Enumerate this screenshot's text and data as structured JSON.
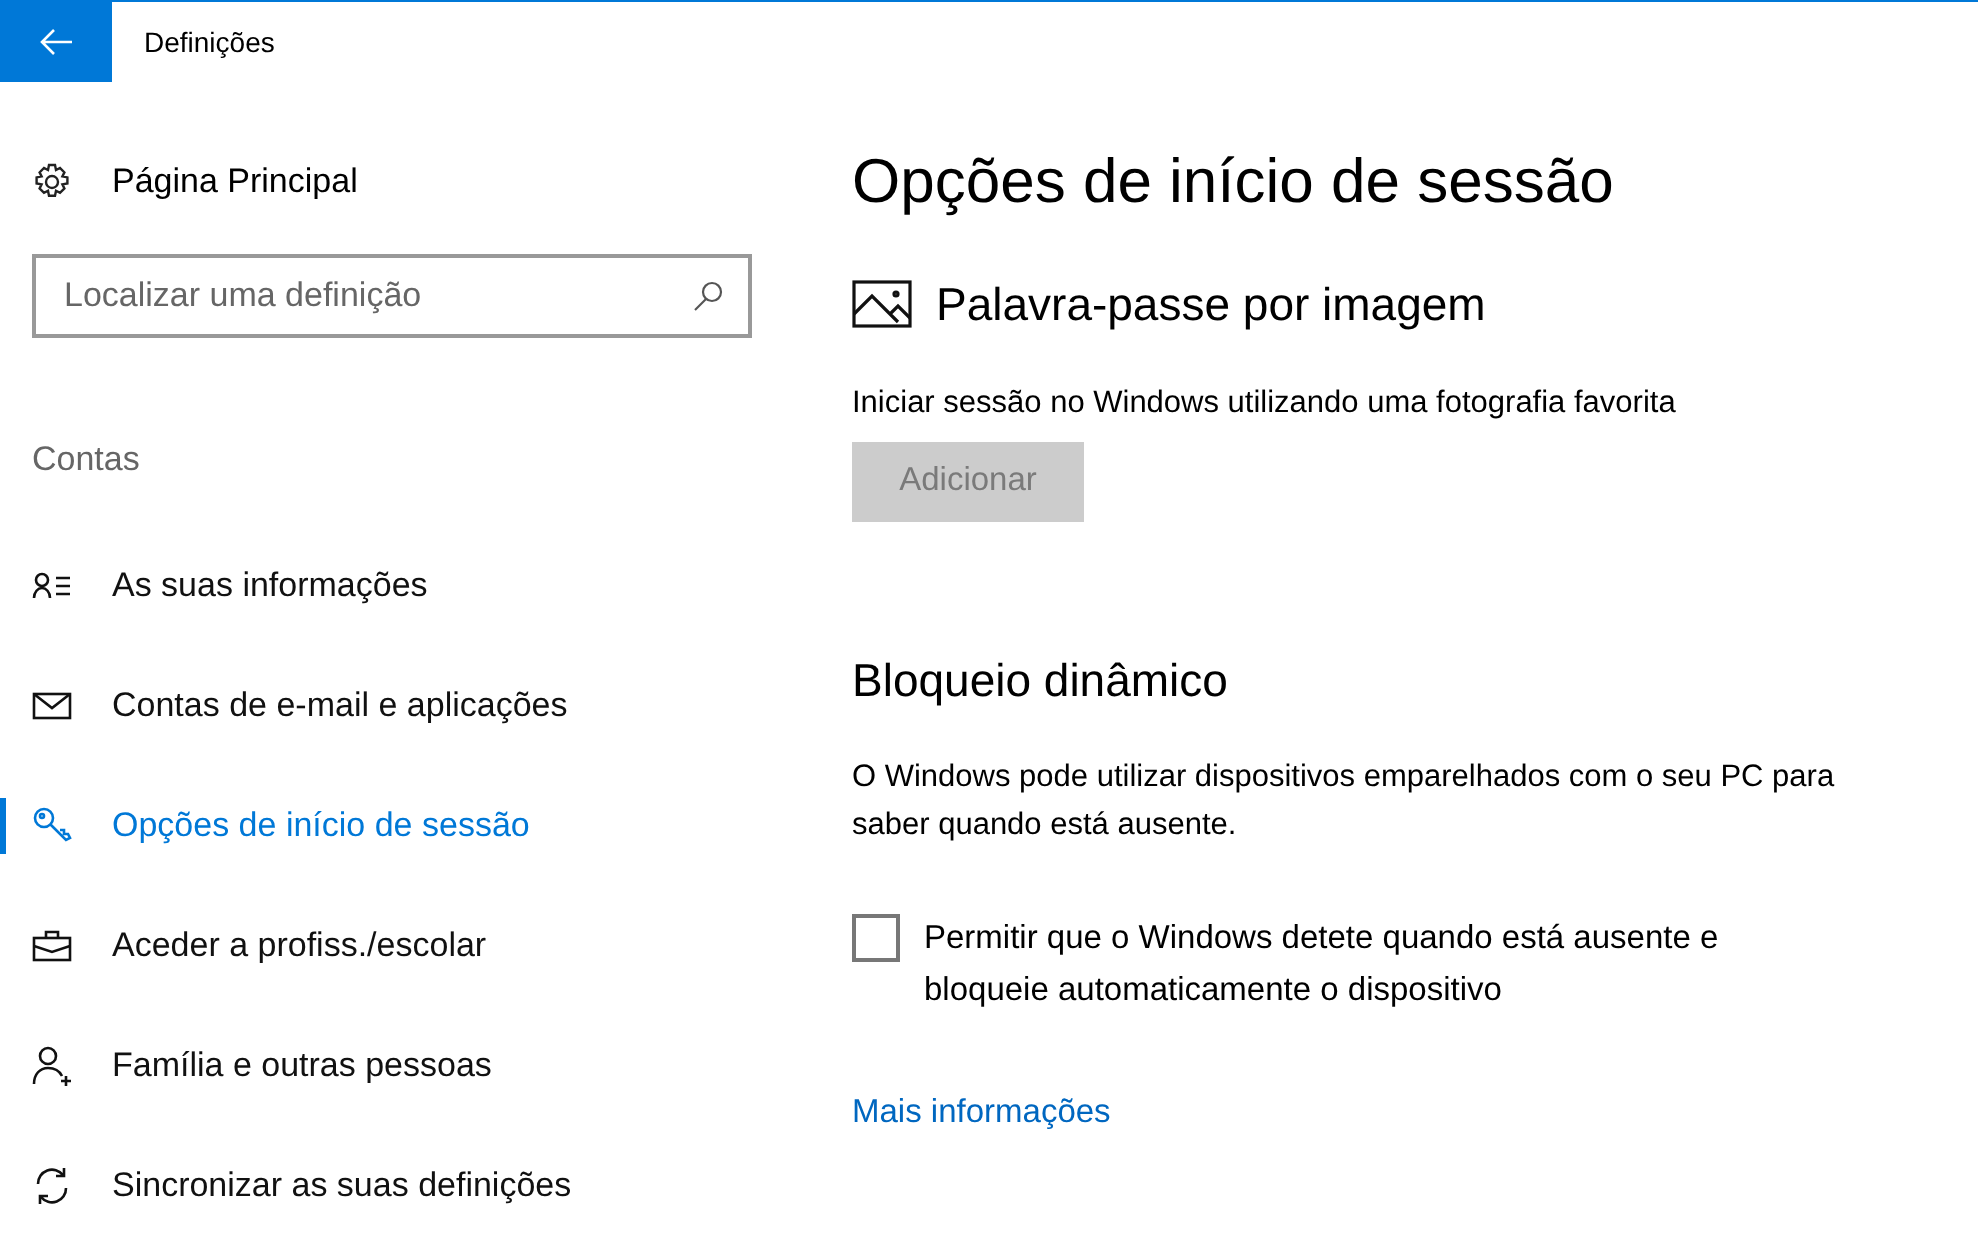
{
  "window": {
    "title": "Definições"
  },
  "sidebar": {
    "home": "Página Principal",
    "search": {
      "placeholder": "Localizar uma definição"
    },
    "section": "Contas",
    "items": [
      {
        "kind": "profile",
        "label": "As suas informações",
        "selected": false
      },
      {
        "kind": "mail",
        "label": "Contas de e-mail e aplicações",
        "selected": false
      },
      {
        "kind": "key",
        "label": "Opções de início de sessão",
        "selected": true
      },
      {
        "kind": "briefcase",
        "label": "Aceder a profiss./escolar",
        "selected": false
      },
      {
        "kind": "family",
        "label": "Família e outras pessoas",
        "selected": false
      },
      {
        "kind": "sync",
        "label": "Sincronizar as suas definições",
        "selected": false
      }
    ]
  },
  "page": {
    "title": "Opções de início de sessão",
    "picture_password": {
      "heading": "Palavra-passe por imagem",
      "description": "Iniciar sessão no Windows utilizando uma fotografia favorita",
      "button": {
        "label": "Adicionar",
        "disabled": true
      }
    },
    "dynamic_lock": {
      "heading": "Bloqueio dinâmico",
      "description": "O Windows pode utilizar dispositivos emparelhados com o seu PC para saber quando está ausente.",
      "checkbox": {
        "label": "Permitir que o Windows detete quando está ausente e bloqueie automaticamente o dispositivo",
        "checked": false
      },
      "link": "Mais informações"
    }
  }
}
